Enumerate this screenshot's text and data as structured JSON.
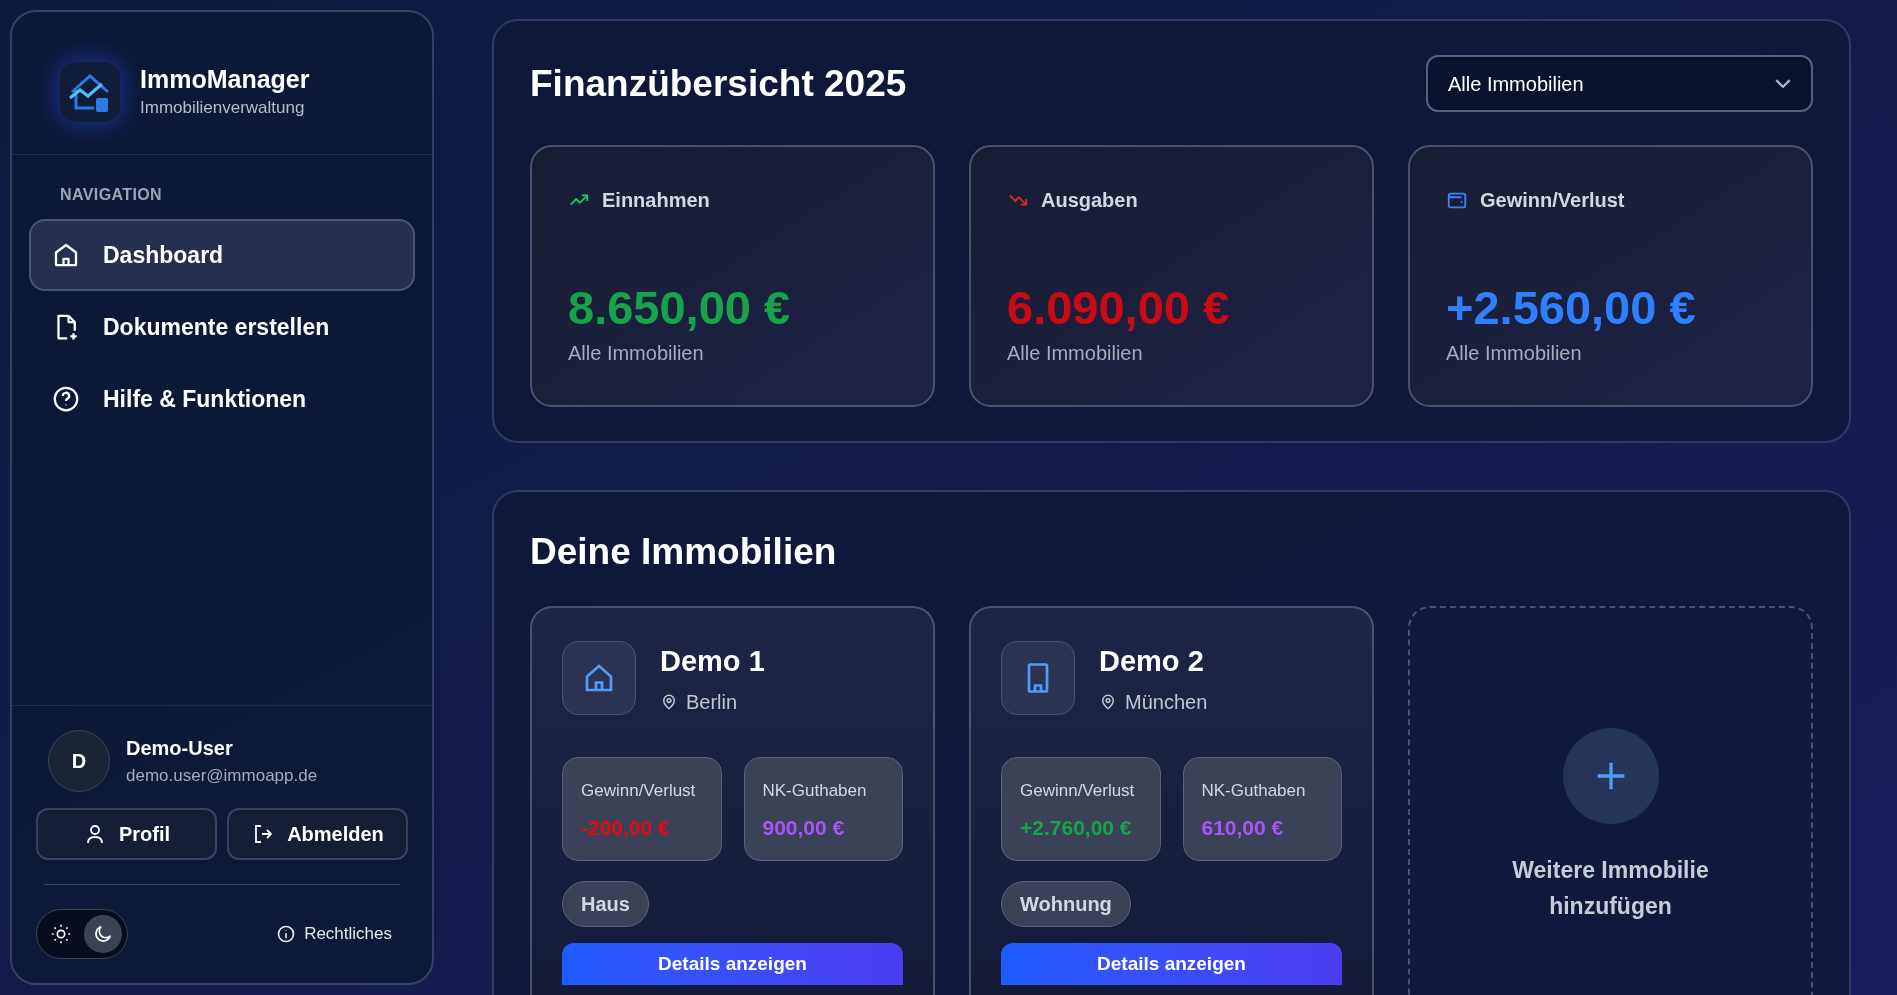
{
  "sidebar": {
    "app_name": "ImmoManager",
    "app_subtitle": "Immobilienverwaltung",
    "nav_heading": "NAVIGATION",
    "nav_items": [
      {
        "kind": "home",
        "label": "Dashboard",
        "selected": true
      },
      {
        "kind": "document",
        "label": "Dokumente erstellen",
        "selected": false
      },
      {
        "kind": "help",
        "label": "Hilfe & Funktionen",
        "selected": false
      }
    ],
    "user": {
      "initial": "D",
      "name": "Demo-User",
      "email": "demo.user@immoapp.de"
    },
    "buttons": [
      {
        "kind": "profile",
        "label": "Profil"
      },
      {
        "kind": "logout",
        "label": "Abmelden"
      }
    ],
    "theme_options": [
      {
        "kind": "light",
        "selected": false
      },
      {
        "kind": "dark",
        "selected": true
      }
    ],
    "legal_link": "Rechtliches"
  },
  "finance": {
    "title": "Finanzübersicht 2025",
    "filter": {
      "value": "Alle Immobilien"
    },
    "cards": [
      {
        "kind": "income",
        "label": "Einnahmen",
        "value": "8.650,00 €",
        "sub": "Alle Immobilien"
      },
      {
        "kind": "expense",
        "label": "Ausgaben",
        "value": "6.090,00 €",
        "sub": "Alle Immobilien"
      },
      {
        "kind": "balance",
        "label": "Gewinn/Verlust",
        "value": "+2.560,00 €",
        "sub": "Alle Immobilien"
      }
    ]
  },
  "properties": {
    "title": "Deine Immobilien",
    "items": [
      {
        "kind": "house",
        "name": "Demo 1",
        "city": "Berlin",
        "stats": [
          {
            "label": "Gewinn/Verlust",
            "value": "-200,00 €",
            "kind": "negative"
          },
          {
            "label": "NK-Guthaben",
            "value": "900,00 €",
            "kind": "credit"
          }
        ],
        "tag": "Haus",
        "button": "Details anzeigen"
      },
      {
        "kind": "building",
        "name": "Demo 2",
        "city": "München",
        "stats": [
          {
            "label": "Gewinn/Verlust",
            "value": "+2.760,00 €",
            "kind": "positive"
          },
          {
            "label": "NK-Guthaben",
            "value": "610,00 €",
            "kind": "credit"
          }
        ],
        "tag": "Wohnung",
        "button": "Details anzeigen"
      }
    ],
    "add_card": {
      "label": "Weitere Immobilie hinzufügen"
    }
  }
}
